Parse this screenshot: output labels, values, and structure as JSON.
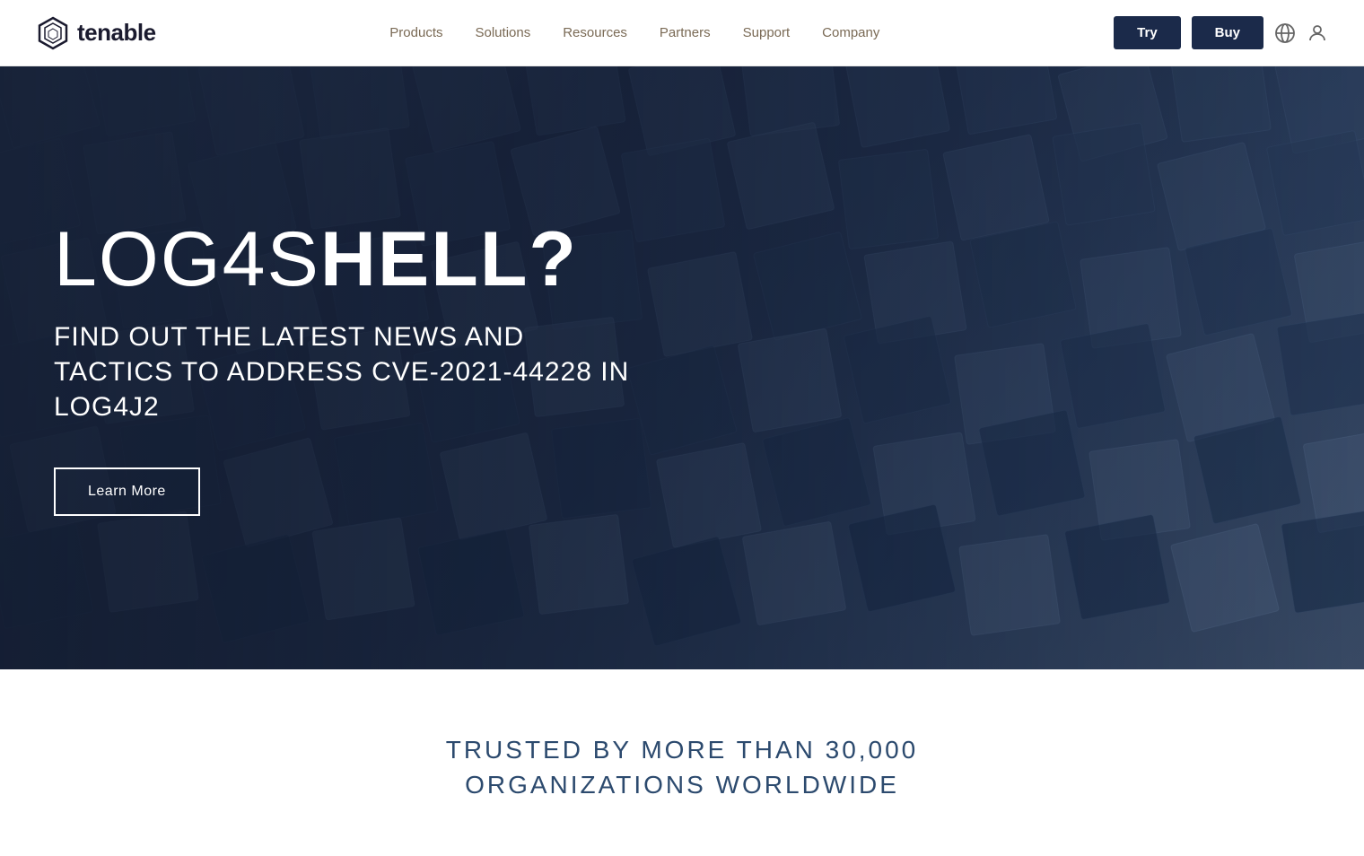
{
  "header": {
    "logo_text": "tenable",
    "nav_items": [
      {
        "label": "Products",
        "id": "products"
      },
      {
        "label": "Solutions",
        "id": "solutions"
      },
      {
        "label": "Resources",
        "id": "resources"
      },
      {
        "label": "Partners",
        "id": "partners"
      },
      {
        "label": "Support",
        "id": "support"
      },
      {
        "label": "Company",
        "id": "company"
      }
    ],
    "try_label": "Try",
    "buy_label": "Buy"
  },
  "hero": {
    "title_light": "LOG4S",
    "title_bold": "HELL?",
    "subtitle": "FIND OUT THE LATEST NEWS AND TACTICS TO ADDRESS CVE-2021-44228 IN LOG4J2",
    "cta_label": "Learn More"
  },
  "trust": {
    "line1": "TRUSTED BY MORE THAN 30,000",
    "line2": "ORGANIZATIONS WORLDWIDE"
  }
}
